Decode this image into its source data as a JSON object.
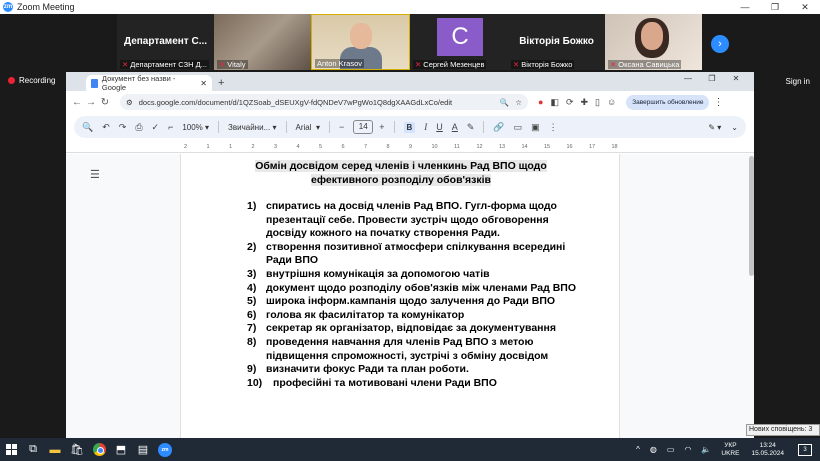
{
  "zoom": {
    "window_title": "Zoom Meeting",
    "recording_label": "Recording",
    "signin_label": "Sign in",
    "tiles": [
      {
        "big_name": "Департамент С...",
        "caption": "Департамент СЗН Д..."
      },
      {
        "caption": "Vitaly"
      },
      {
        "caption": "Anton Krasov"
      },
      {
        "avatar_letter": "С",
        "caption": "Сергей Мезенцев"
      },
      {
        "big_name": "Вікторія Божко",
        "caption": "Вікторія Божко"
      },
      {
        "caption": "Оксана Савицька"
      }
    ]
  },
  "browser": {
    "tab_title": "Документ без назви - Google",
    "url": "docs.google.com/document/d/1QZSoab_dSEUXgV-fdQNDeV7wPgWo1Q8dgXAAGdLxCo/edit",
    "update_label": "Завершить обновление"
  },
  "docs": {
    "zoom_level": "100%",
    "style_select": "Звичайни...",
    "font_select": "Arial",
    "font_size": "14",
    "ruler_labels": [
      "2",
      "1",
      "1",
      "2",
      "3",
      "4",
      "5",
      "6",
      "7",
      "8",
      "9",
      "10",
      "11",
      "12",
      "13",
      "14",
      "15",
      "16",
      "17",
      "18"
    ],
    "title_line1": "Обмін досвідом серед членів і членкинь Рад ВПО щодо",
    "title_line2": "ефективного розподілу обов'язків",
    "items": [
      {
        "num": "1)",
        "text": "спиратись на досвід членів Рад ВПО. Гугл-форма щодо презентації себе. Провести зустріч щодо обговорення досвіду кожного на початку створення Ради."
      },
      {
        "num": "2)",
        "text": "створення позитивної атмосфери спілкування всередині Ради ВПО"
      },
      {
        "num": "3)",
        "text": "внутрішня комунікація за допомогою чатів"
      },
      {
        "num": "4)",
        "text": "документ щодо розподілу обов'язків між членами Рад ВПО"
      },
      {
        "num": "5)",
        "text": "широка інформ.кампанія щодо залучення до Ради ВПО"
      },
      {
        "num": "6)",
        "text": "голова як фасилітатор та комунікатор"
      },
      {
        "num": "7)",
        "text": "секретар як організатор, відповідає за документування"
      },
      {
        "num": "8)",
        "text": "проведення навчання для членів Рад ВПО з метою підвищення спроможності, зустрічі з обміну досвідом"
      },
      {
        "num": "9)",
        "text": "визначити фокус Ради та план роботи."
      },
      {
        "num": "10)",
        "text": "професійні та мотивовані члени Ради ВПО"
      }
    ]
  },
  "toast": "Нових сповіщень: 3",
  "taskbar": {
    "lang_top": "УКР",
    "lang_bottom": "UKRE",
    "time": "13:24",
    "date": "15.05.2024",
    "notif_count": "3"
  }
}
